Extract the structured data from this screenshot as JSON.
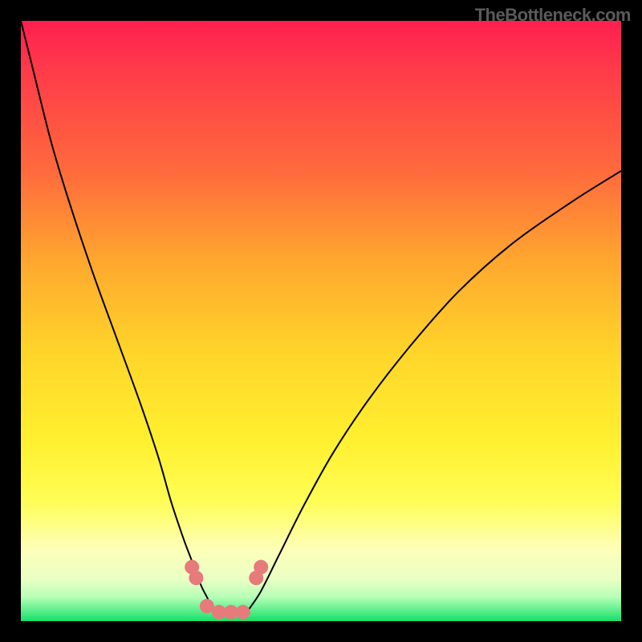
{
  "watermark": "TheBottleneck.com",
  "chart_data": {
    "type": "line",
    "title": "",
    "xlabel": "",
    "ylabel": "",
    "xlim": [
      0,
      100
    ],
    "ylim": [
      0,
      100
    ],
    "grid": false,
    "legend": false,
    "background_gradient": [
      {
        "pos": 0,
        "color": "#ff1f4f"
      },
      {
        "pos": 25,
        "color": "#ff6a3c"
      },
      {
        "pos": 55,
        "color": "#ffd42a"
      },
      {
        "pos": 85,
        "color": "#fdffb8"
      },
      {
        "pos": 100,
        "color": "#14e06a"
      }
    ],
    "series": [
      {
        "name": "left-branch",
        "x": [
          0,
          2,
          5,
          8,
          12,
          16,
          20,
          23,
          25,
          27,
          28.5,
          30,
          31,
          32
        ],
        "y": [
          100,
          92,
          80,
          70,
          58,
          47,
          36,
          27,
          20,
          14,
          10,
          6,
          4,
          2
        ]
      },
      {
        "name": "right-branch",
        "x": [
          38,
          40,
          43,
          47,
          52,
          58,
          65,
          73,
          82,
          92,
          100
        ],
        "y": [
          2,
          5,
          11,
          19,
          28,
          37,
          46,
          55,
          63,
          70,
          75
        ]
      }
    ],
    "markers": {
      "name": "bottom-markers",
      "x": [
        28.5,
        29.2,
        31,
        33,
        35,
        37,
        39.2,
        40
      ],
      "y": [
        9,
        7.2,
        2.5,
        1.5,
        1.5,
        1.5,
        7.2,
        9
      ]
    }
  }
}
